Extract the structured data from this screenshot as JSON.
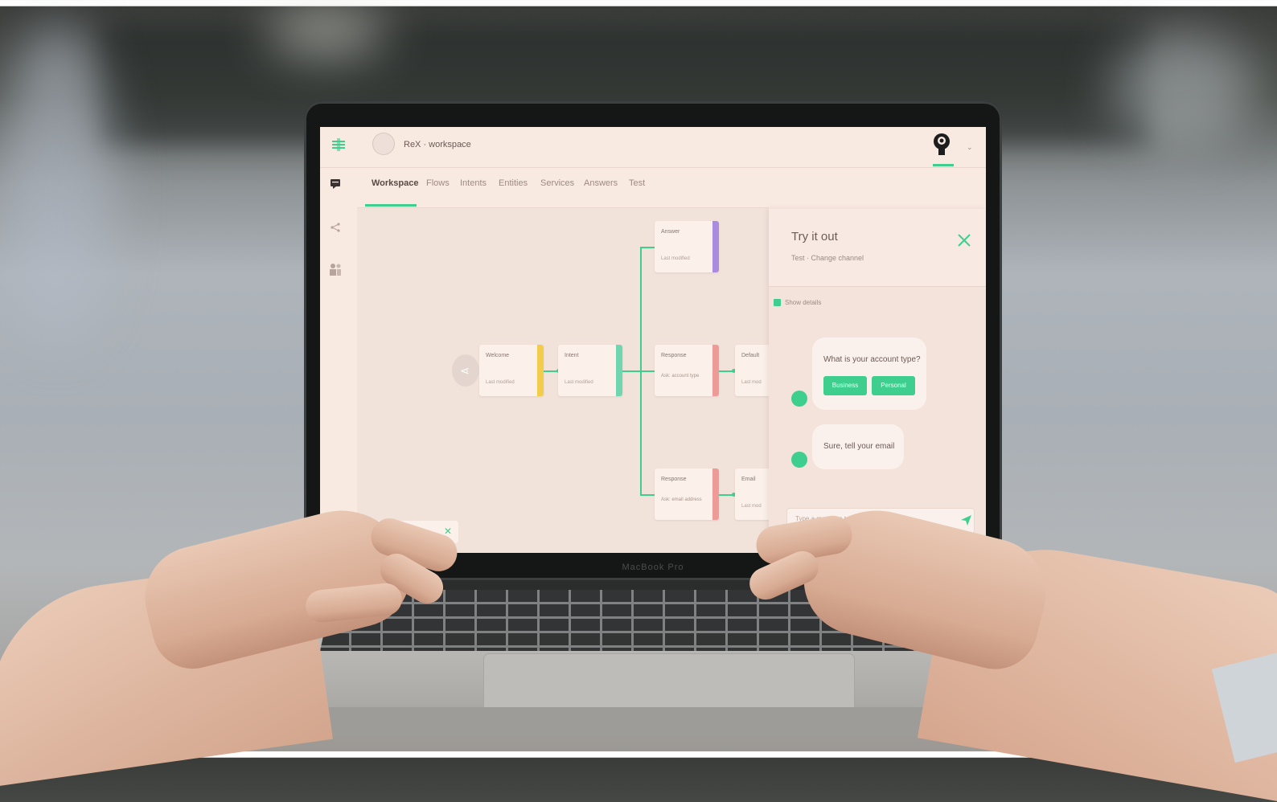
{
  "colors": {
    "accent": "#3ecf8e",
    "screen_bg": "#f8e9e1",
    "node_yellow": "#f2cd4b",
    "node_teal": "#6fd6b0",
    "node_purple": "#a98ce0",
    "node_red": "#ee9a96"
  },
  "header": {
    "workspace_name": "ReX · workspace",
    "workspace_chevron": "⌄",
    "user_chevron": "⌄"
  },
  "tabs": [
    {
      "label": "Workspace",
      "active": true
    },
    {
      "label": "Flows",
      "active": false
    },
    {
      "label": "Intents",
      "active": false
    },
    {
      "label": "Entities",
      "active": false
    },
    {
      "label": "Services",
      "active": false
    },
    {
      "label": "Answers",
      "active": false
    },
    {
      "label": "Test",
      "active": false
    }
  ],
  "canvas": {
    "nodes": [
      {
        "label": "Welcome",
        "sub": "Last modified",
        "color": "#f2cd4b"
      },
      {
        "label": "Intent",
        "sub": "Last modified",
        "color": "#6fd6b0"
      },
      {
        "label": "Answer",
        "sub": "Last modified",
        "color": "#a98ce0"
      },
      {
        "label": "Response",
        "desc": "Ask: account type",
        "color": "#ee9a96"
      },
      {
        "label": "Default",
        "sub": "Last mod",
        "color": "#ee9a96"
      },
      {
        "label": "Response",
        "desc": "Ask: email address",
        "color": "#ee9a96"
      },
      {
        "label": "Email",
        "sub": "Last mod",
        "color": "#ee9a96"
      }
    ]
  },
  "chat": {
    "title": "Try it out",
    "subtitle": "Test · Change channel",
    "show_debug_label": "Show details",
    "question": "What is your account type?",
    "options": [
      "Business",
      "Personal"
    ],
    "reply": "Sure, tell your email",
    "input_placeholder": "Type a message to test your bot..."
  },
  "laptop": {
    "brand": "MacBook Pro"
  }
}
